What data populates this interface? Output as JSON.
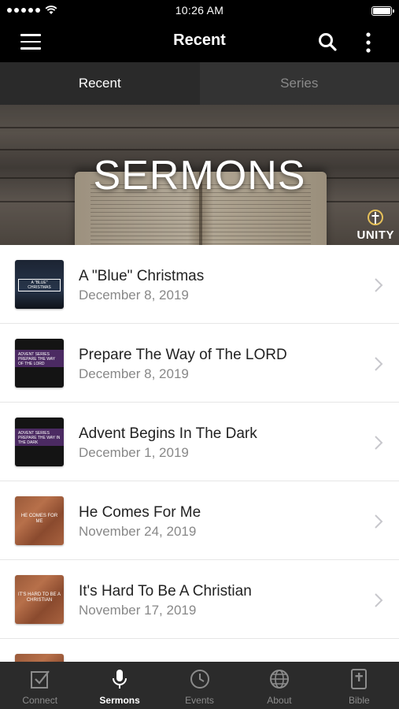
{
  "status": {
    "time": "10:26 AM"
  },
  "nav": {
    "title": "Recent"
  },
  "tabs": [
    {
      "label": "Recent",
      "active": true
    },
    {
      "label": "Series",
      "active": false
    }
  ],
  "hero": {
    "title": "SERMONS",
    "logo_text": "UNITY"
  },
  "sermons": [
    {
      "title": "A \"Blue\" Christmas",
      "date": "December 8, 2019",
      "thumb_text": "A \"BLUE\" CHRISTMAS"
    },
    {
      "title": "Prepare The Way of The LORD",
      "date": "December 8, 2019",
      "thumb_text": "ADVENT SERIES PREPARE THE WAY OF THE LORD"
    },
    {
      "title": "Advent Begins In The Dark",
      "date": "December 1, 2019",
      "thumb_text": "ADVENT SERIES PREPARE THE WAY IN THE DARK"
    },
    {
      "title": "He Comes For Me",
      "date": "November 24, 2019",
      "thumb_text": "HE COMES FOR ME"
    },
    {
      "title": "It's Hard To Be A Christian",
      "date": "November 17, 2019",
      "thumb_text": "IT'S HARD TO BE A CHRISTIAN"
    }
  ],
  "tabbar": [
    {
      "label": "Connect",
      "icon": "checkbox-icon",
      "active": false
    },
    {
      "label": "Sermons",
      "icon": "microphone-icon",
      "active": true
    },
    {
      "label": "Events",
      "icon": "clock-icon",
      "active": false
    },
    {
      "label": "About",
      "icon": "globe-icon",
      "active": false
    },
    {
      "label": "Bible",
      "icon": "bible-icon",
      "active": false
    }
  ],
  "colors": {
    "nav_bg": "#000000",
    "tab_active_bg": "#2a2a2a",
    "tabbar_bg": "#2b2b2b",
    "date_gray": "#888888"
  }
}
